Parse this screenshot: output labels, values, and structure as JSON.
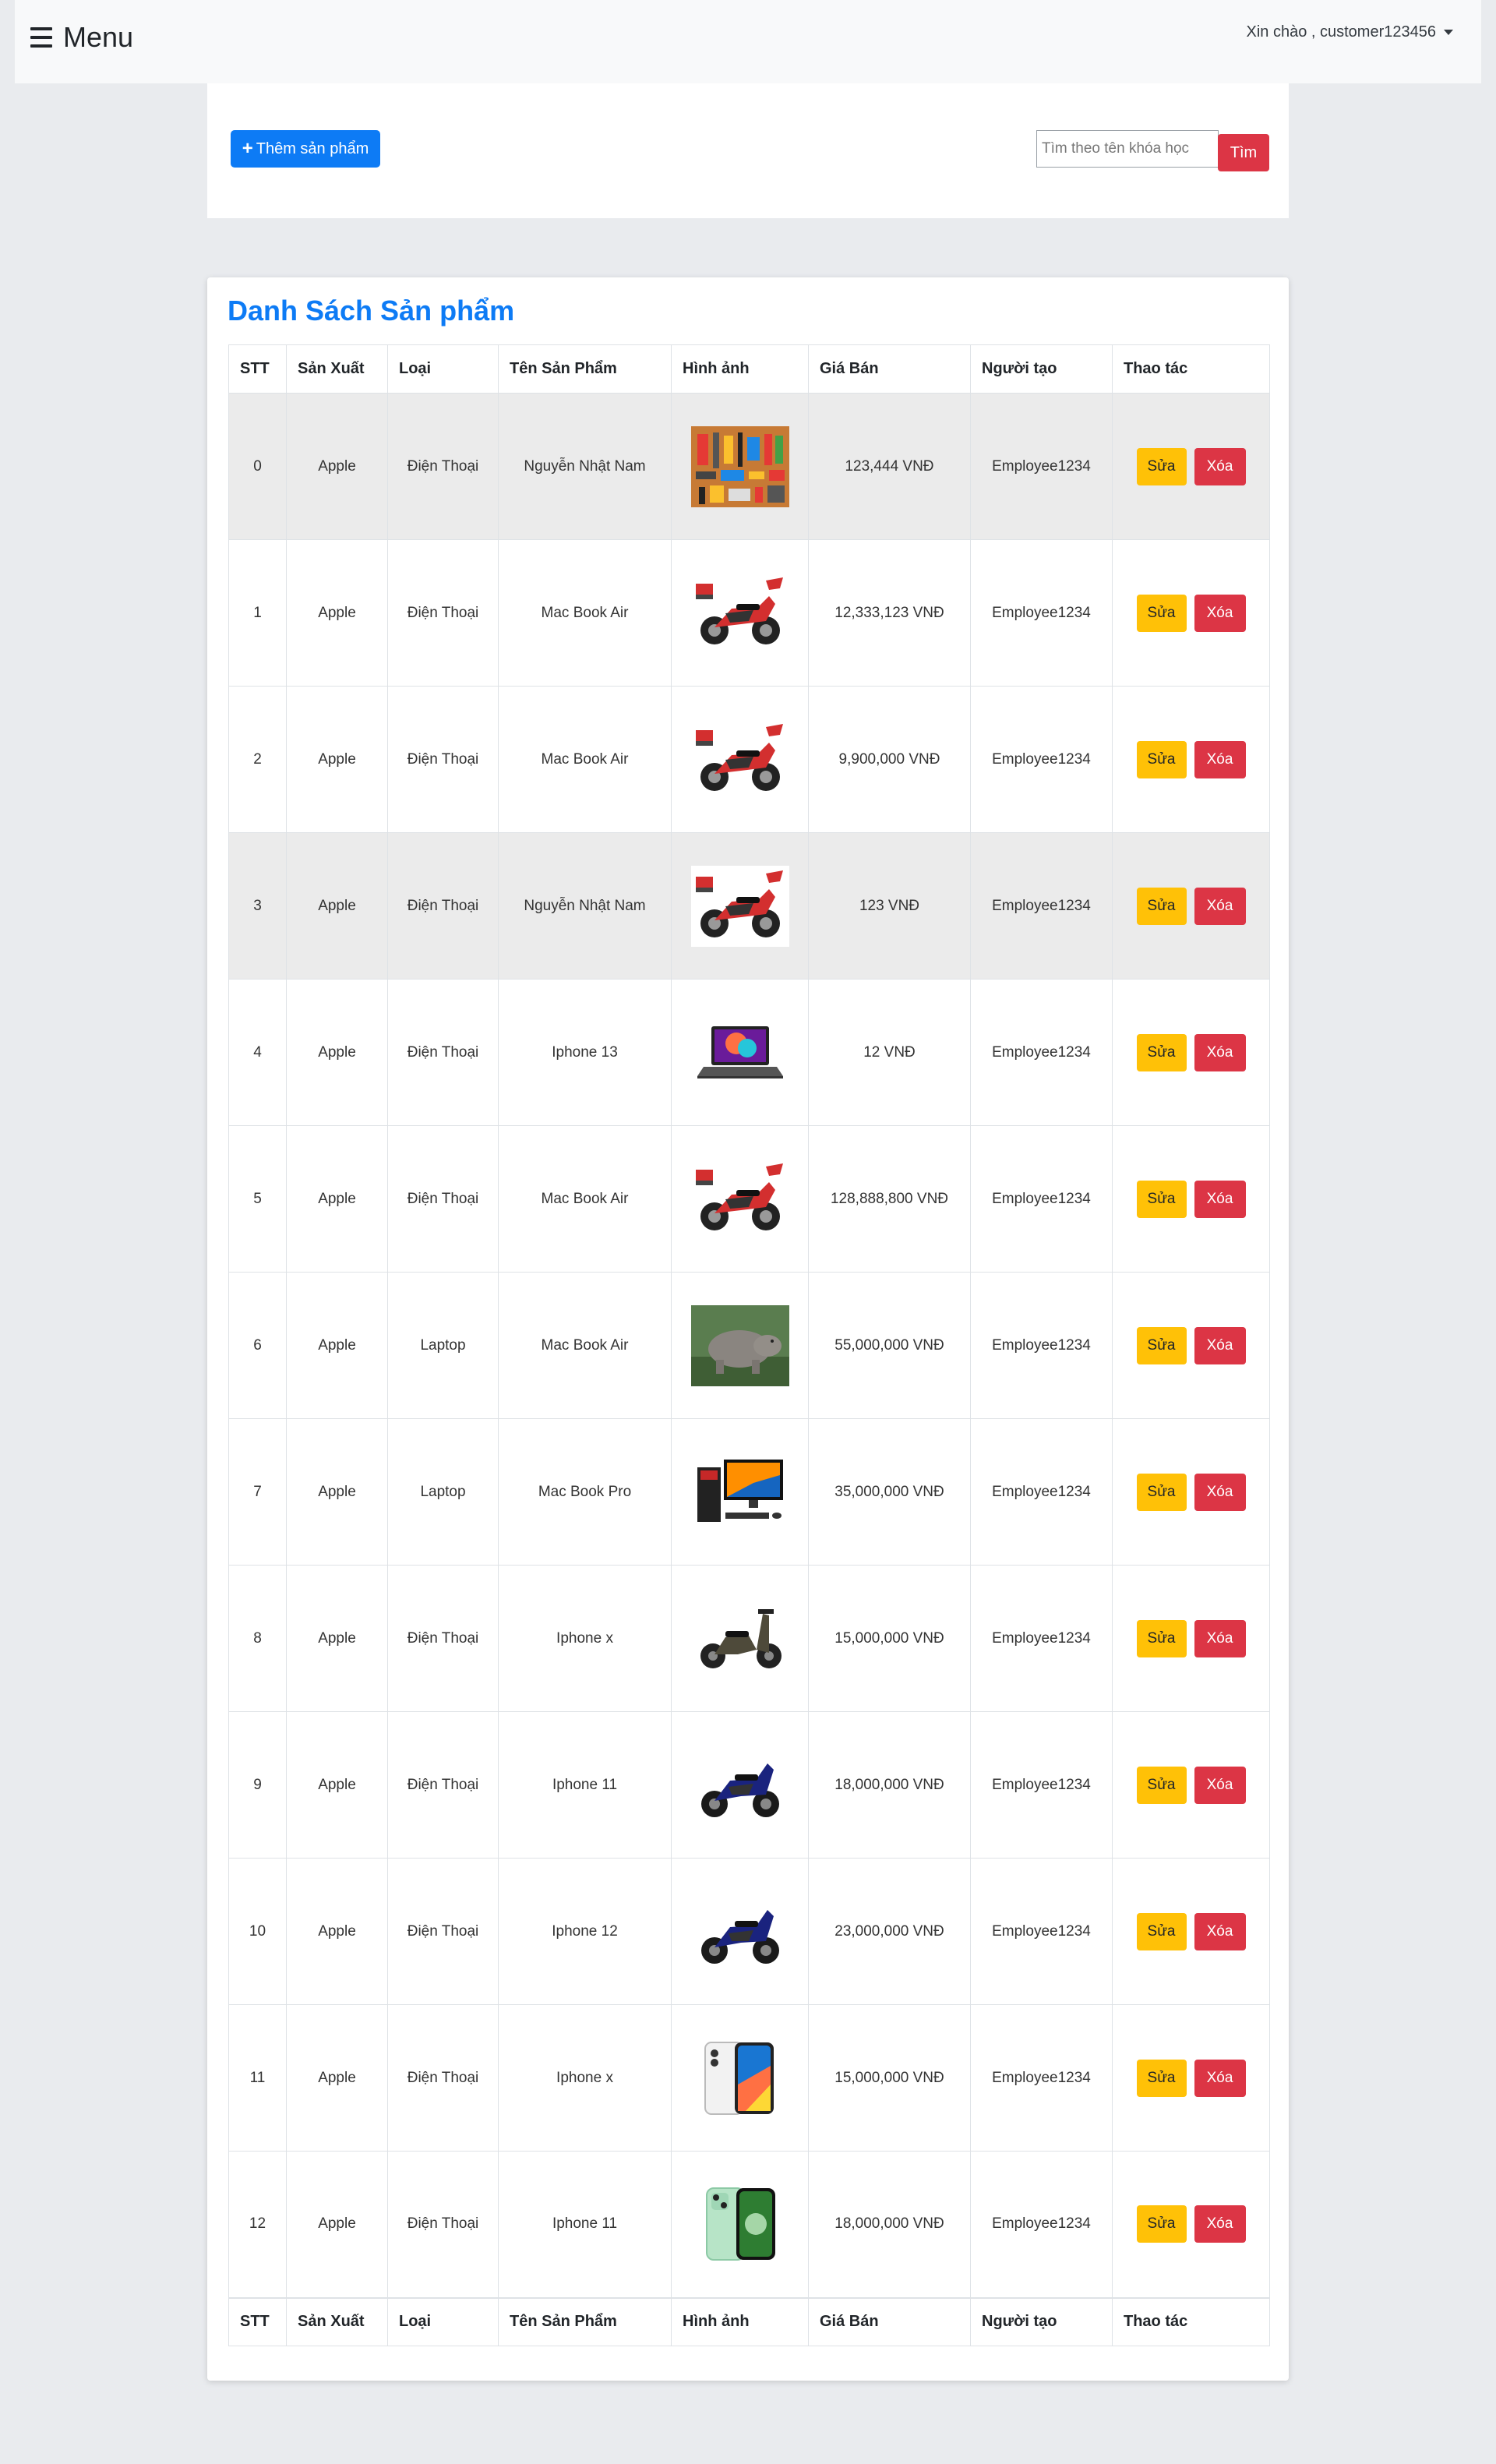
{
  "navbar": {
    "menu_label": "Menu",
    "user_greeting": "Xin chào , customer123456"
  },
  "toolbar": {
    "add_label": "Thêm sản phẩm",
    "search_placeholder": "Tìm theo tên khóa học",
    "search_label": "Tìm"
  },
  "list": {
    "title": "Danh Sách Sản phẩm",
    "columns": [
      "STT",
      "Sản Xuất",
      "Loại",
      "Tên Sản Phẩm",
      "Hình ảnh",
      "Giá Bán",
      "Người tạo",
      "Thao tác"
    ],
    "edit_label": "Sửa",
    "delete_label": "Xóa",
    "rows": [
      {
        "stt": "0",
        "maker": "Apple",
        "type": "Điện Thoại",
        "name": "Nguyễn Nhật Nam",
        "image": "tools-image",
        "price": "123,444 VNĐ",
        "creator": "Employee1234",
        "shaded": true
      },
      {
        "stt": "1",
        "maker": "Apple",
        "type": "Điện Thoại",
        "name": "Mac Book Air",
        "image": "motorbike-red-image",
        "price": "12,333,123 VNĐ",
        "creator": "Employee1234",
        "shaded": false
      },
      {
        "stt": "2",
        "maker": "Apple",
        "type": "Điện Thoại",
        "name": "Mac Book Air",
        "image": "motorbike-red-image",
        "price": "9,900,000 VNĐ",
        "creator": "Employee1234",
        "shaded": false
      },
      {
        "stt": "3",
        "maker": "Apple",
        "type": "Điện Thoại",
        "name": "Nguyễn Nhật Nam",
        "image": "motorbike-red-image",
        "price": "123 VNĐ",
        "creator": "Employee1234",
        "shaded": true
      },
      {
        "stt": "4",
        "maker": "Apple",
        "type": "Điện Thoại",
        "name": "Iphone 13",
        "image": "laptop-image",
        "price": "12 VNĐ",
        "creator": "Employee1234",
        "shaded": false
      },
      {
        "stt": "5",
        "maker": "Apple",
        "type": "Điện Thoại",
        "name": "Mac Book Air",
        "image": "motorbike-red-image",
        "price": "128,888,800 VNĐ",
        "creator": "Employee1234",
        "shaded": false
      },
      {
        "stt": "6",
        "maker": "Apple",
        "type": "Laptop",
        "name": "Mac Book Air",
        "image": "hippo-image",
        "price": "55,000,000 VNĐ",
        "creator": "Employee1234",
        "shaded": false
      },
      {
        "stt": "7",
        "maker": "Apple",
        "type": "Laptop",
        "name": "Mac Book Pro",
        "image": "desktop-pc-image",
        "price": "35,000,000 VNĐ",
        "creator": "Employee1234",
        "shaded": false
      },
      {
        "stt": "8",
        "maker": "Apple",
        "type": "Điện Thoại",
        "name": "Iphone x",
        "image": "scooter-image",
        "price": "15,000,000 VNĐ",
        "creator": "Employee1234",
        "shaded": false
      },
      {
        "stt": "9",
        "maker": "Apple",
        "type": "Điện Thoại",
        "name": "Iphone 11",
        "image": "motorbike-blue-image",
        "price": "18,000,000 VNĐ",
        "creator": "Employee1234",
        "shaded": false
      },
      {
        "stt": "10",
        "maker": "Apple",
        "type": "Điện Thoại",
        "name": "Iphone 12",
        "image": "motorbike-blue-image",
        "price": "23,000,000 VNĐ",
        "creator": "Employee1234",
        "shaded": false
      },
      {
        "stt": "11",
        "maker": "Apple",
        "type": "Điện Thoại",
        "name": "Iphone x",
        "image": "iphone-x-image",
        "price": "15,000,000 VNĐ",
        "creator": "Employee1234",
        "shaded": false
      },
      {
        "stt": "12",
        "maker": "Apple",
        "type": "Điện Thoại",
        "name": "Iphone 11",
        "image": "iphone-11-image",
        "price": "18,000,000 VNĐ",
        "creator": "Employee1234",
        "shaded": false
      }
    ]
  },
  "colors": {
    "primary": "#0d7bf5",
    "danger": "#dc3545",
    "warning": "#ffc107",
    "page_bg": "#e9ebee",
    "navbar_bg": "#f8f9fa"
  }
}
